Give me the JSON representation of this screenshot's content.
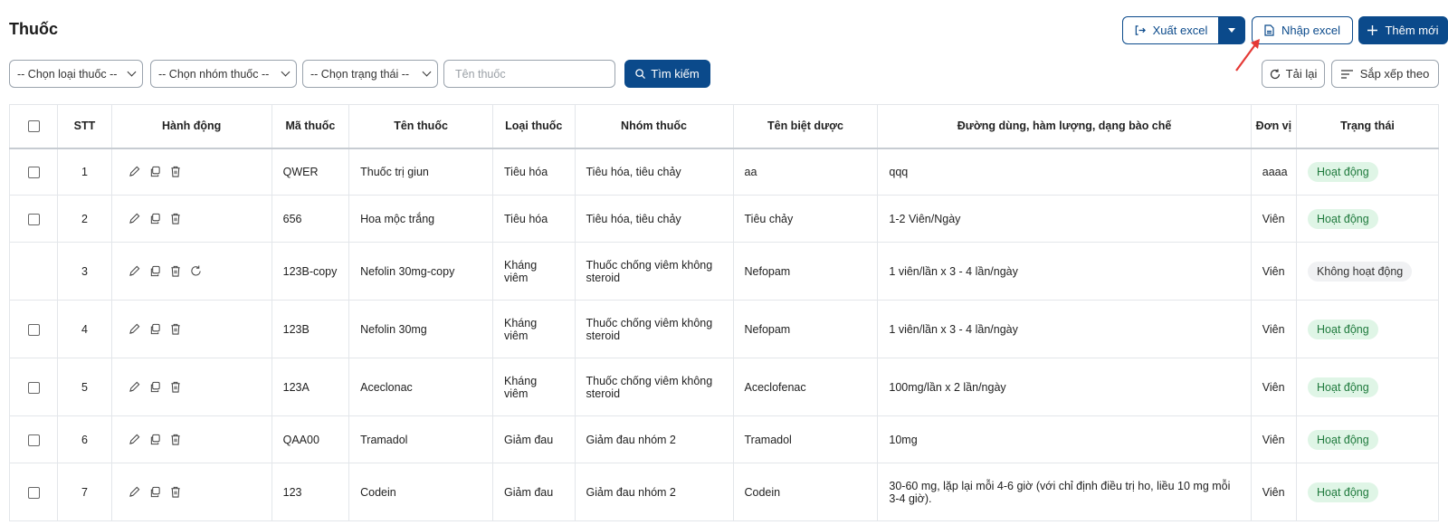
{
  "page": {
    "title": "Thuốc"
  },
  "toolbar": {
    "export_label": "Xuất excel",
    "import_label": "Nhập excel",
    "add_label": "Thêm mới",
    "reload_label": "Tải lại",
    "sort_label": "Sắp xếp theo",
    "search_label": "Tìm kiếm"
  },
  "filters": {
    "drug_type": "-- Chọn loại thuốc --",
    "drug_group": "-- Chọn nhóm thuốc --",
    "status": "-- Chọn trạng thái --",
    "name_placeholder": "Tên thuốc"
  },
  "colors": {
    "primary": "#0b4a8b",
    "active_bg": "#dff5e6",
    "active_text": "#1f7a3d",
    "arrow": "#e53935"
  },
  "table": {
    "headers": {
      "stt": "STT",
      "actions": "Hành động",
      "code": "Mã thuốc",
      "name": "Tên thuốc",
      "type": "Loại thuốc",
      "group": "Nhóm thuốc",
      "brand": "Tên biệt dược",
      "usage": "Đường dùng, hàm lượng, dạng bào chế",
      "unit": "Đơn vị",
      "status": "Trạng thái"
    },
    "rows": [
      {
        "stt": "1",
        "code": "QWER",
        "name": "Thuốc trị giun",
        "type": "Tiêu hóa",
        "group": "Tiêu hóa, tiêu chảy",
        "brand": "aa",
        "usage": "qqq",
        "unit": "aaaa",
        "status": "Hoạt động"
      },
      {
        "stt": "2",
        "code": "656",
        "name": "Hoa mộc trắng",
        "type": "Tiêu hóa",
        "group": "Tiêu hóa, tiêu chảy",
        "brand": "Tiêu chảy",
        "usage": "1-2 Viên/Ngày",
        "unit": "Viên",
        "status": "Hoạt động"
      },
      {
        "stt": "3",
        "code": "123B-copy",
        "name": "Nefolin 30mg-copy",
        "type": "Kháng viêm",
        "group": "Thuốc chống viêm không steroid",
        "brand": "Nefopam",
        "usage": "1 viên/lần x 3 - 4 lần/ngày",
        "unit": "Viên",
        "status": "Không hoạt động"
      },
      {
        "stt": "4",
        "code": "123B",
        "name": "Nefolin 30mg",
        "type": "Kháng viêm",
        "group": "Thuốc chống viêm không steroid",
        "brand": "Nefopam",
        "usage": "1 viên/lần x 3 - 4 lần/ngày",
        "unit": "Viên",
        "status": "Hoạt động"
      },
      {
        "stt": "5",
        "code": "123A",
        "name": "Aceclonac",
        "type": "Kháng viêm",
        "group": "Thuốc chống viêm không steroid",
        "brand": "Aceclofenac",
        "usage": "100mg/lần x 2 lần/ngày",
        "unit": "Viên",
        "status": "Hoạt động"
      },
      {
        "stt": "6",
        "code": "QAA00",
        "name": "Tramadol",
        "type": "Giảm đau",
        "group": "Giảm đau nhóm 2",
        "brand": "Tramadol",
        "usage": "10mg",
        "unit": "Viên",
        "status": "Hoạt động"
      },
      {
        "stt": "7",
        "code": "123",
        "name": "Codein",
        "type": "Giảm đau",
        "group": "Giảm đau nhóm 2",
        "brand": "Codein",
        "usage": "30-60 mg, lặp lại mỗi 4-6 giờ (với chỉ định điều trị ho, liều 10 mg mỗi 3-4 giờ).",
        "unit": "Viên",
        "status": "Hoạt động"
      }
    ]
  }
}
